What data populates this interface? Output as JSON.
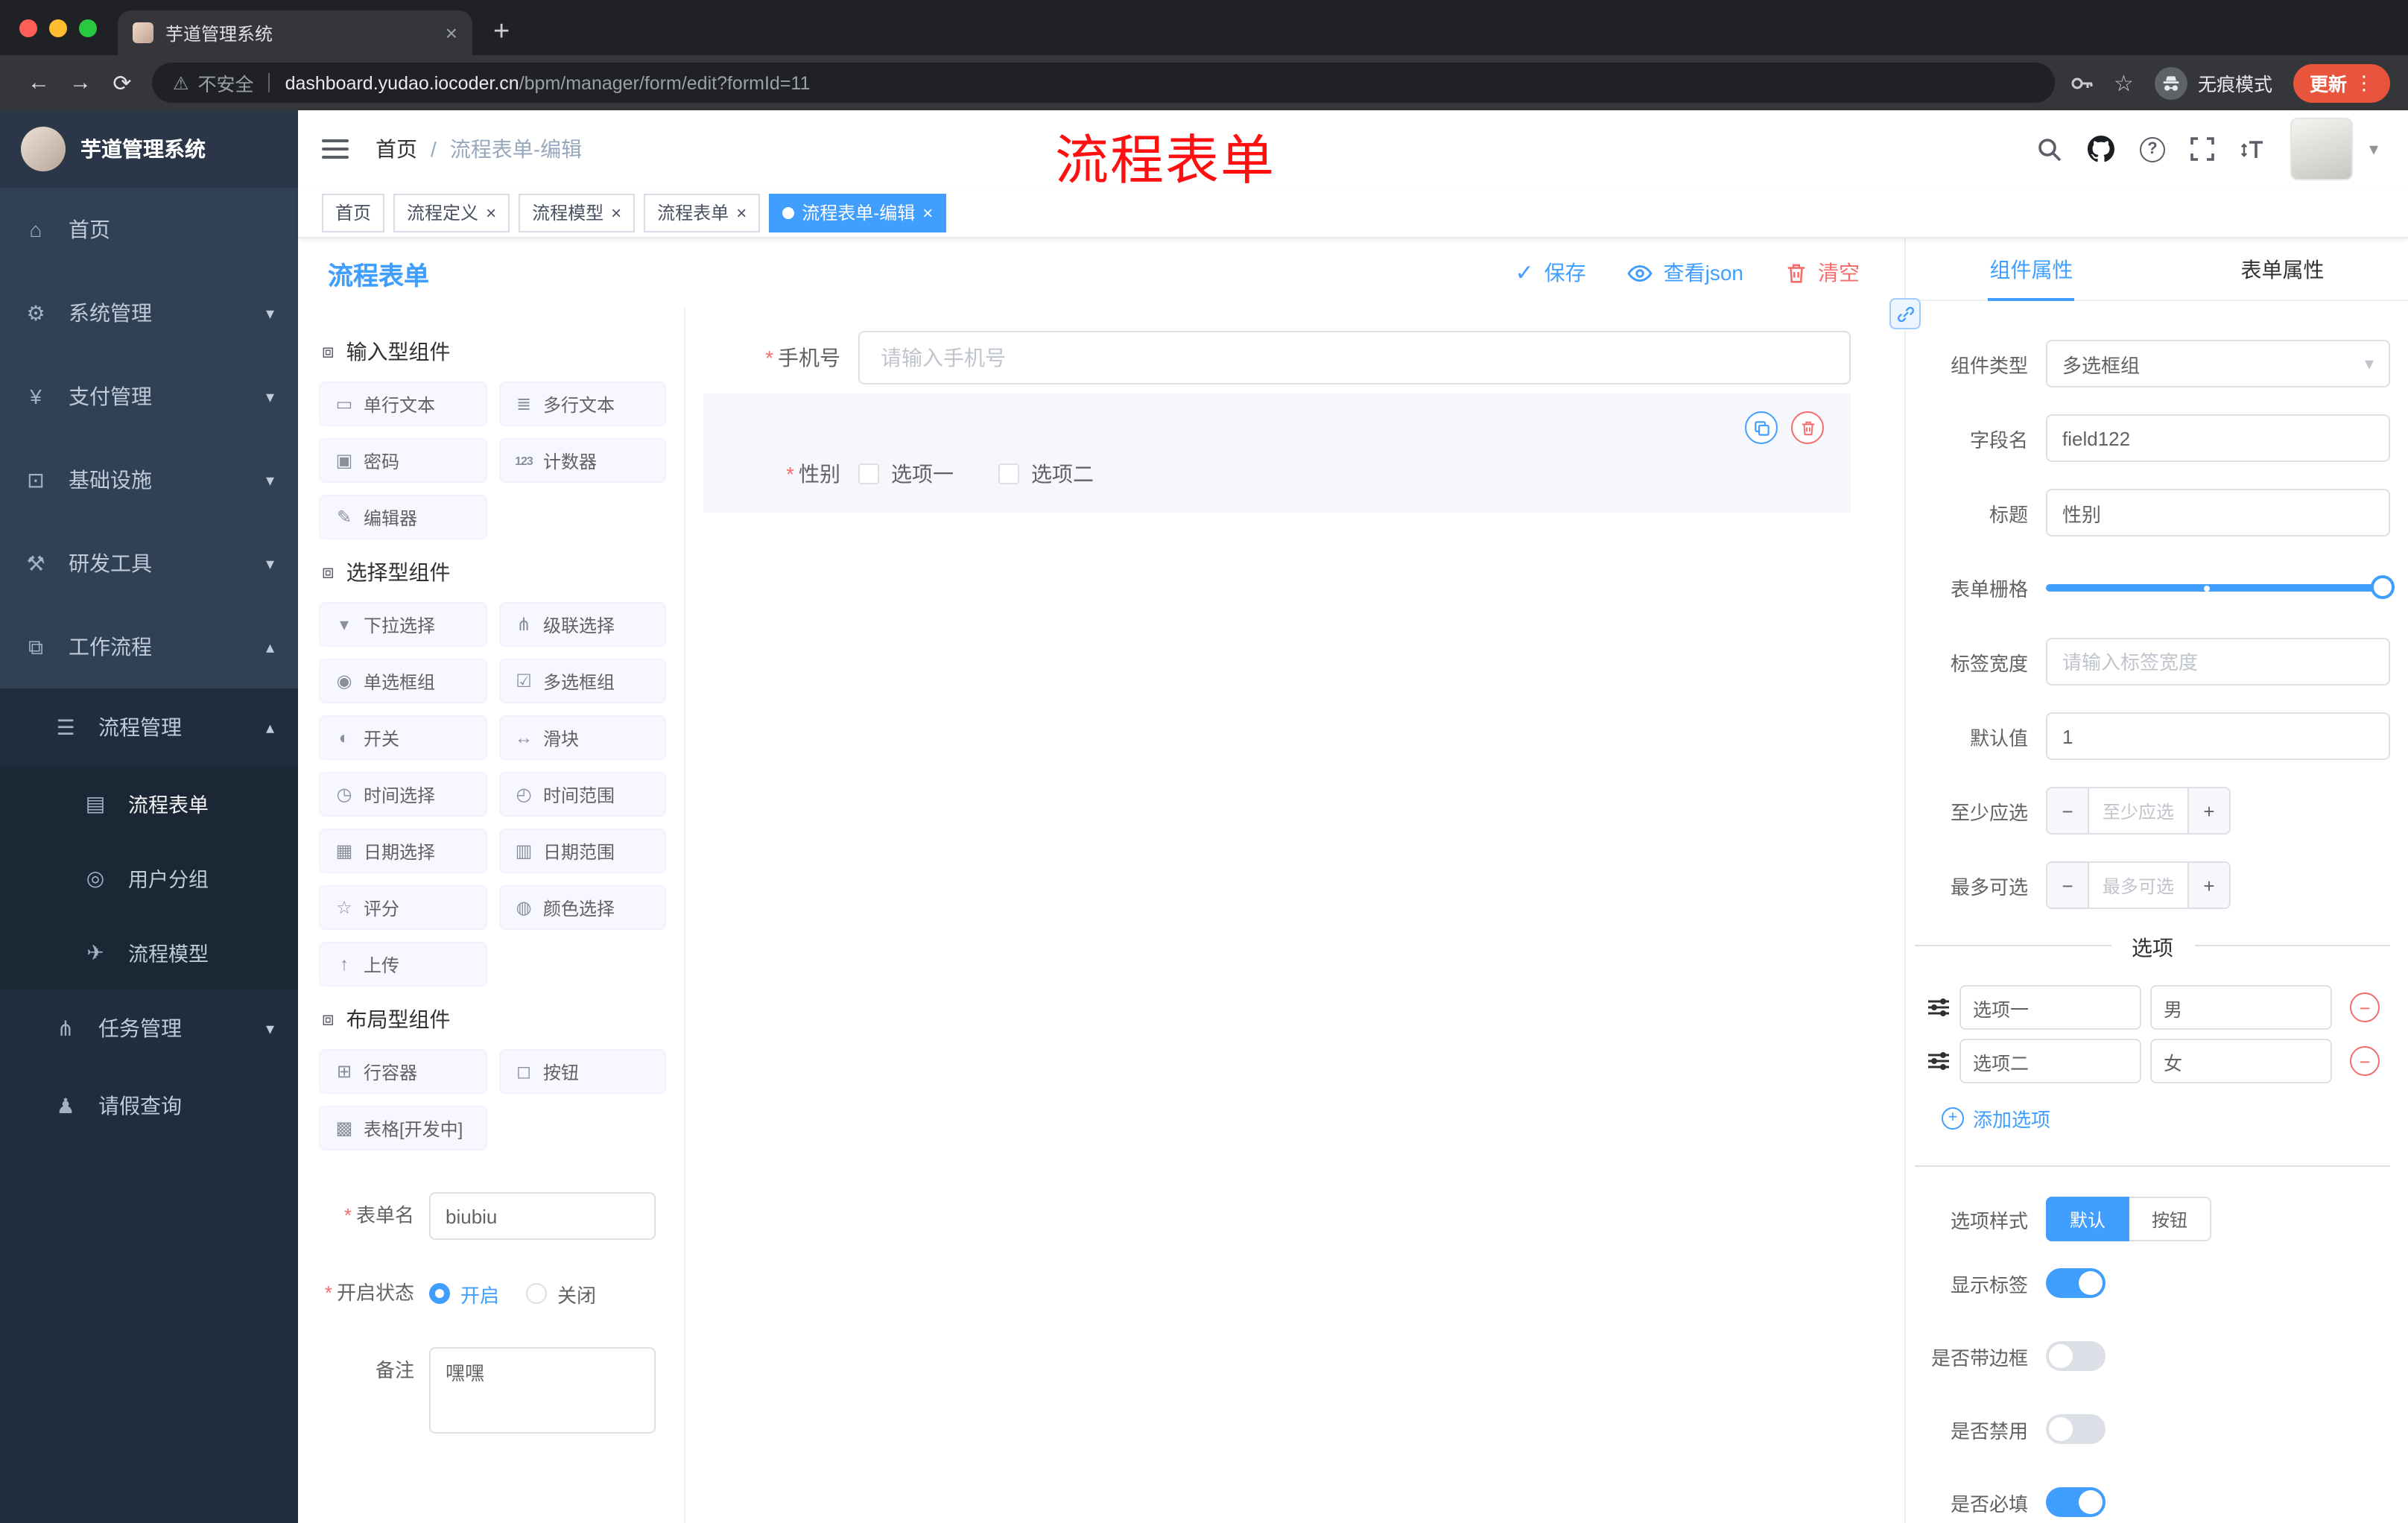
{
  "colors": {
    "accent": "#409eff",
    "danger": "#f56c6c",
    "annotation": "#ff0f0f",
    "update_button": "#e8543c",
    "sidebar_bg": "#304156"
  },
  "icons": {
    "close": "×",
    "plus": "+",
    "minus": "−",
    "back": "←",
    "forward": "→",
    "reload": "⟳",
    "warning": "⚠",
    "star": "☆",
    "kebab": "⋮",
    "caret_down": "▾",
    "caret_up": "▴",
    "check": "✓",
    "question": "?"
  },
  "browser": {
    "tab_title": "芋道管理系统",
    "security_label": "不安全",
    "url_host": "dashboard.yudao.iocoder.cn",
    "url_path": "/bpm/manager/form/edit?formId=11",
    "incognito_label": "无痕模式",
    "update_label": "更新"
  },
  "annotation": {
    "text": "流程表单"
  },
  "sidebar": {
    "logo_title": "芋道管理系统",
    "menu": [
      {
        "label": "首页",
        "icon": "⌂"
      },
      {
        "label": "系统管理",
        "icon": "⚙"
      },
      {
        "label": "支付管理",
        "icon": "¥"
      },
      {
        "label": "基础设施",
        "icon": "⊡"
      },
      {
        "label": "研发工具",
        "icon": "⚒"
      },
      {
        "label": "工作流程",
        "icon": "⧉"
      },
      {
        "label": "流程管理",
        "icon": "☰"
      },
      {
        "label": "流程表单",
        "icon": "▤"
      },
      {
        "label": "用户分组",
        "icon": "◎"
      },
      {
        "label": "流程模型",
        "icon": "✈"
      },
      {
        "label": "任务管理",
        "icon": "⋔"
      },
      {
        "label": "请假查询",
        "icon": "♟"
      }
    ]
  },
  "header": {
    "breadcrumb": {
      "home": "首页",
      "separator": "/",
      "current": "流程表单-编辑"
    }
  },
  "tags": [
    {
      "label": "首页"
    },
    {
      "label": "流程定义"
    },
    {
      "label": "流程模型"
    },
    {
      "label": "流程表单"
    },
    {
      "label": "流程表单-编辑"
    }
  ],
  "designer": {
    "title": "流程表单",
    "required_marker": "*",
    "actions": {
      "save": "保存",
      "view_json": "查看json",
      "clear": "清空"
    },
    "palette": {
      "groups": [
        {
          "title": "输入型组件",
          "icon": "⧈",
          "items": [
            {
              "label": "单行文本",
              "icon": "▭"
            },
            {
              "label": "多行文本",
              "icon": "≣"
            },
            {
              "label": "密码",
              "icon": "▣"
            },
            {
              "label": "计数器",
              "icon": "123"
            },
            {
              "label": "编辑器",
              "icon": "✎"
            }
          ]
        },
        {
          "title": "选择型组件",
          "icon": "⧈",
          "items": [
            {
              "label": "下拉选择",
              "icon": "▾"
            },
            {
              "label": "级联选择",
              "icon": "⋔"
            },
            {
              "label": "单选框组",
              "icon": "◉"
            },
            {
              "label": "多选框组",
              "icon": "☑"
            },
            {
              "label": "开关",
              "icon": "◐"
            },
            {
              "label": "滑块",
              "icon": "↔"
            },
            {
              "label": "时间选择",
              "icon": "◷"
            },
            {
              "label": "时间范围",
              "icon": "◴"
            },
            {
              "label": "日期选择",
              "icon": "▦"
            },
            {
              "label": "日期范围",
              "icon": "▥"
            },
            {
              "label": "评分",
              "icon": "☆"
            },
            {
              "label": "颜色选择",
              "icon": "◍"
            },
            {
              "label": "上传",
              "icon": "↑"
            }
          ]
        },
        {
          "title": "布局型组件",
          "icon": "⧈",
          "items": [
            {
              "label": "行容器",
              "icon": "⊞"
            },
            {
              "label": "按钮",
              "icon": "◻"
            },
            {
              "label": "表格[开发中]",
              "icon": "▩"
            }
          ]
        }
      ]
    },
    "form_meta": {
      "name_label": "表单名",
      "name_value": "biubiu",
      "status_label": "开启状态",
      "status_on": "开启",
      "status_off": "关闭",
      "remark_label": "备注",
      "remark_value": "嘿嘿"
    },
    "canvas": {
      "phone_label": "手机号",
      "phone_placeholder": "请输入手机号",
      "gender_label": "性别",
      "gender_options": [
        "选项一",
        "选项二"
      ]
    }
  },
  "props": {
    "tabs": {
      "component": "组件属性",
      "form": "表单属性"
    },
    "component_type": {
      "label": "组件类型",
      "value": "多选框组"
    },
    "field_name": {
      "label": "字段名",
      "value": "field122"
    },
    "title": {
      "label": "标题",
      "value": "性别"
    },
    "grid": {
      "label": "表单栅格"
    },
    "label_width": {
      "label": "标签宽度",
      "placeholder": "请输入标签宽度"
    },
    "default_value": {
      "label": "默认值",
      "value": "1"
    },
    "min_select": {
      "label": "至少应选",
      "placeholder": "至少应选"
    },
    "max_select": {
      "label": "最多可选",
      "placeholder": "最多可选"
    },
    "options_title": "选项",
    "options": [
      {
        "name": "选项一",
        "value": "男"
      },
      {
        "name": "选项二",
        "value": "女"
      }
    ],
    "add_option": "添加选项",
    "option_style": {
      "label": "选项样式",
      "default": "默认",
      "button": "按钮"
    },
    "switches": [
      {
        "label": "显示标签",
        "on": true
      },
      {
        "label": "是否带边框",
        "on": false
      },
      {
        "label": "是否禁用",
        "on": false
      },
      {
        "label": "是否必填",
        "on": true
      }
    ]
  }
}
